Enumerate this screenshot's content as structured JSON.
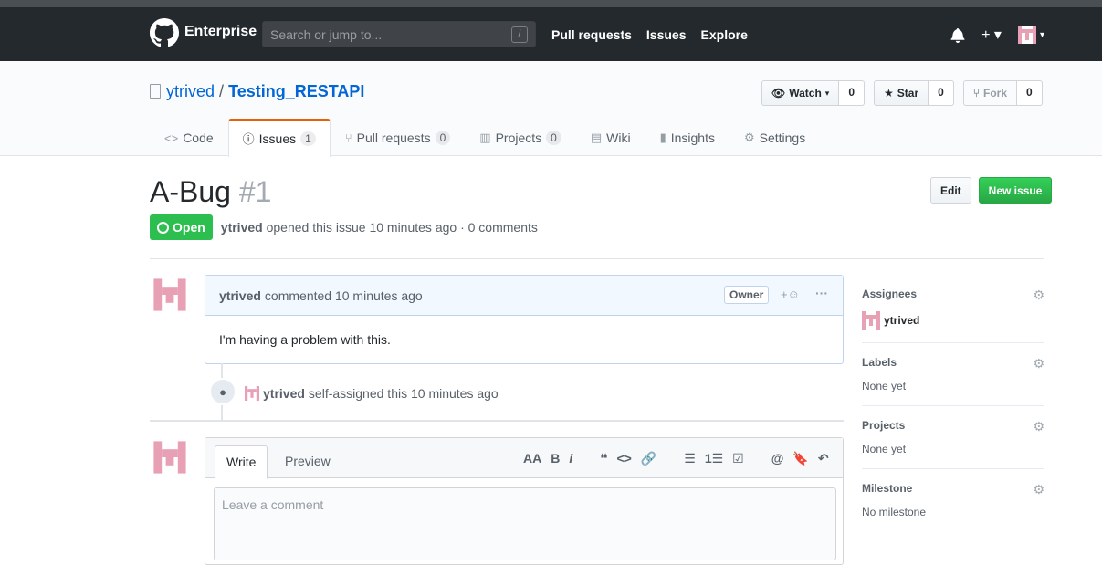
{
  "header": {
    "brand": "Enterprise",
    "search_placeholder": "Search or jump to...",
    "search_slash": "/",
    "nav": [
      "Pull requests",
      "Issues",
      "Explore"
    ],
    "icons": [
      "bell-icon",
      "plus-icon",
      "avatar"
    ]
  },
  "repo": {
    "owner": "ytrived",
    "separator": "/",
    "name": "Testing_RESTAPI",
    "watch_label": "Watch",
    "watch_count": "0",
    "star_label": "Star",
    "star_count": "0",
    "fork_label": "Fork",
    "fork_count": "0"
  },
  "tabs": [
    {
      "label": "Code",
      "icon": "code-icon"
    },
    {
      "label": "Issues",
      "icon": "issue-icon",
      "count": "1"
    },
    {
      "label": "Pull requests",
      "icon": "pull-request-icon",
      "count": "0"
    },
    {
      "label": "Projects",
      "icon": "project-icon",
      "count": "0"
    },
    {
      "label": "Wiki",
      "icon": "book-icon"
    },
    {
      "label": "Insights",
      "icon": "graph-icon"
    },
    {
      "label": "Settings",
      "icon": "gear-icon"
    }
  ],
  "issue": {
    "title": "A-Bug",
    "number": "#1",
    "edit_label": "Edit",
    "new_label": "New issue",
    "state": "Open",
    "author": "ytrived",
    "meta": "opened this issue 10 minutes ago · 0 comments"
  },
  "comment": {
    "author": "ytrived",
    "action": "commented 10 minutes ago",
    "badge": "Owner",
    "reaction": "+☺",
    "more": "···",
    "body": "I'm having a problem with this."
  },
  "event": {
    "author": "ytrived",
    "text": "self-assigned this 10 minutes ago"
  },
  "new_comment": {
    "tab_write": "Write",
    "tab_preview": "Preview",
    "placeholder": "Leave a comment",
    "toolbar": [
      "AA",
      "B",
      "i",
      "❝",
      "<>",
      "🔗",
      "☰",
      "1☰",
      "☑",
      "@",
      "🔖",
      "↶"
    ]
  },
  "sidebar": {
    "assignees_label": "Assignees",
    "assignee": "ytrived",
    "labels_label": "Labels",
    "labels_value": "None yet",
    "projects_label": "Projects",
    "projects_value": "None yet",
    "milestone_label": "Milestone",
    "milestone_value": "No milestone"
  },
  "colors": {
    "header_bg": "#24292e",
    "link": "#0366d6",
    "open_green": "#2cbe4e",
    "new_issue_green": "#28a745",
    "active_tab_border": "#e36209",
    "avatar_pink": "#e8a0b4"
  }
}
